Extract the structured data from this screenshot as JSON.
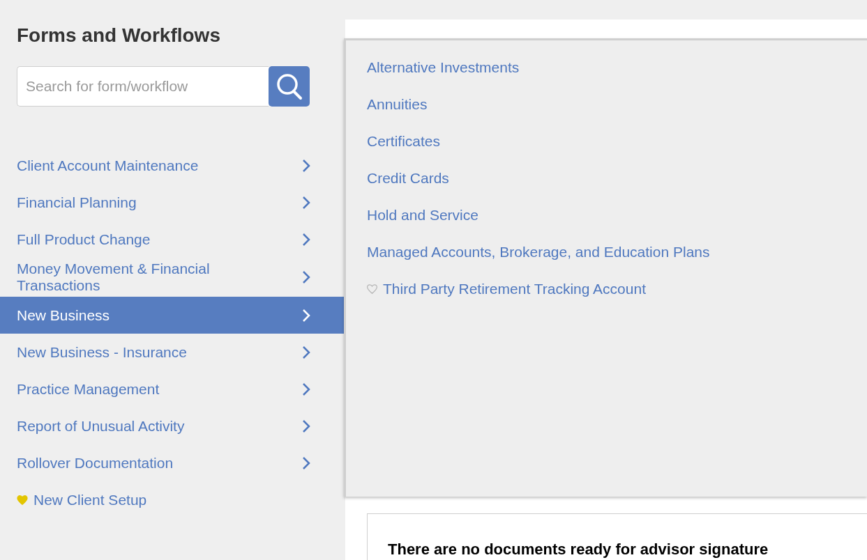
{
  "sidebar": {
    "title": "Forms and Workflows",
    "search": {
      "placeholder": "Search for form/workflow"
    },
    "items": [
      {
        "label": "Client Account Maintenance",
        "selected": false
      },
      {
        "label": "Financial Planning",
        "selected": false
      },
      {
        "label": "Full Product Change",
        "selected": false
      },
      {
        "label": "Money Movement & Financial Transactions",
        "selected": false
      },
      {
        "label": "New Business",
        "selected": true
      },
      {
        "label": "New Business - Insurance",
        "selected": false
      },
      {
        "label": "Practice Management",
        "selected": false
      },
      {
        "label": "Report of Unusual Activity",
        "selected": false
      },
      {
        "label": "Rollover Documentation",
        "selected": false
      }
    ],
    "favorites": [
      {
        "label": "New Client Setup",
        "favorite": true
      }
    ]
  },
  "flyout": {
    "items": [
      {
        "label": "Alternative Investments"
      },
      {
        "label": "Annuities"
      },
      {
        "label": "Certificates"
      },
      {
        "label": "Credit Cards"
      },
      {
        "label": "Hold and Service"
      },
      {
        "label": "Managed Accounts, Brokerage, and Education Plans"
      },
      {
        "label": "Third Party Retirement Tracking Account",
        "favorite": false
      }
    ]
  },
  "documents": {
    "message": "There are no documents ready for advisor signature"
  }
}
